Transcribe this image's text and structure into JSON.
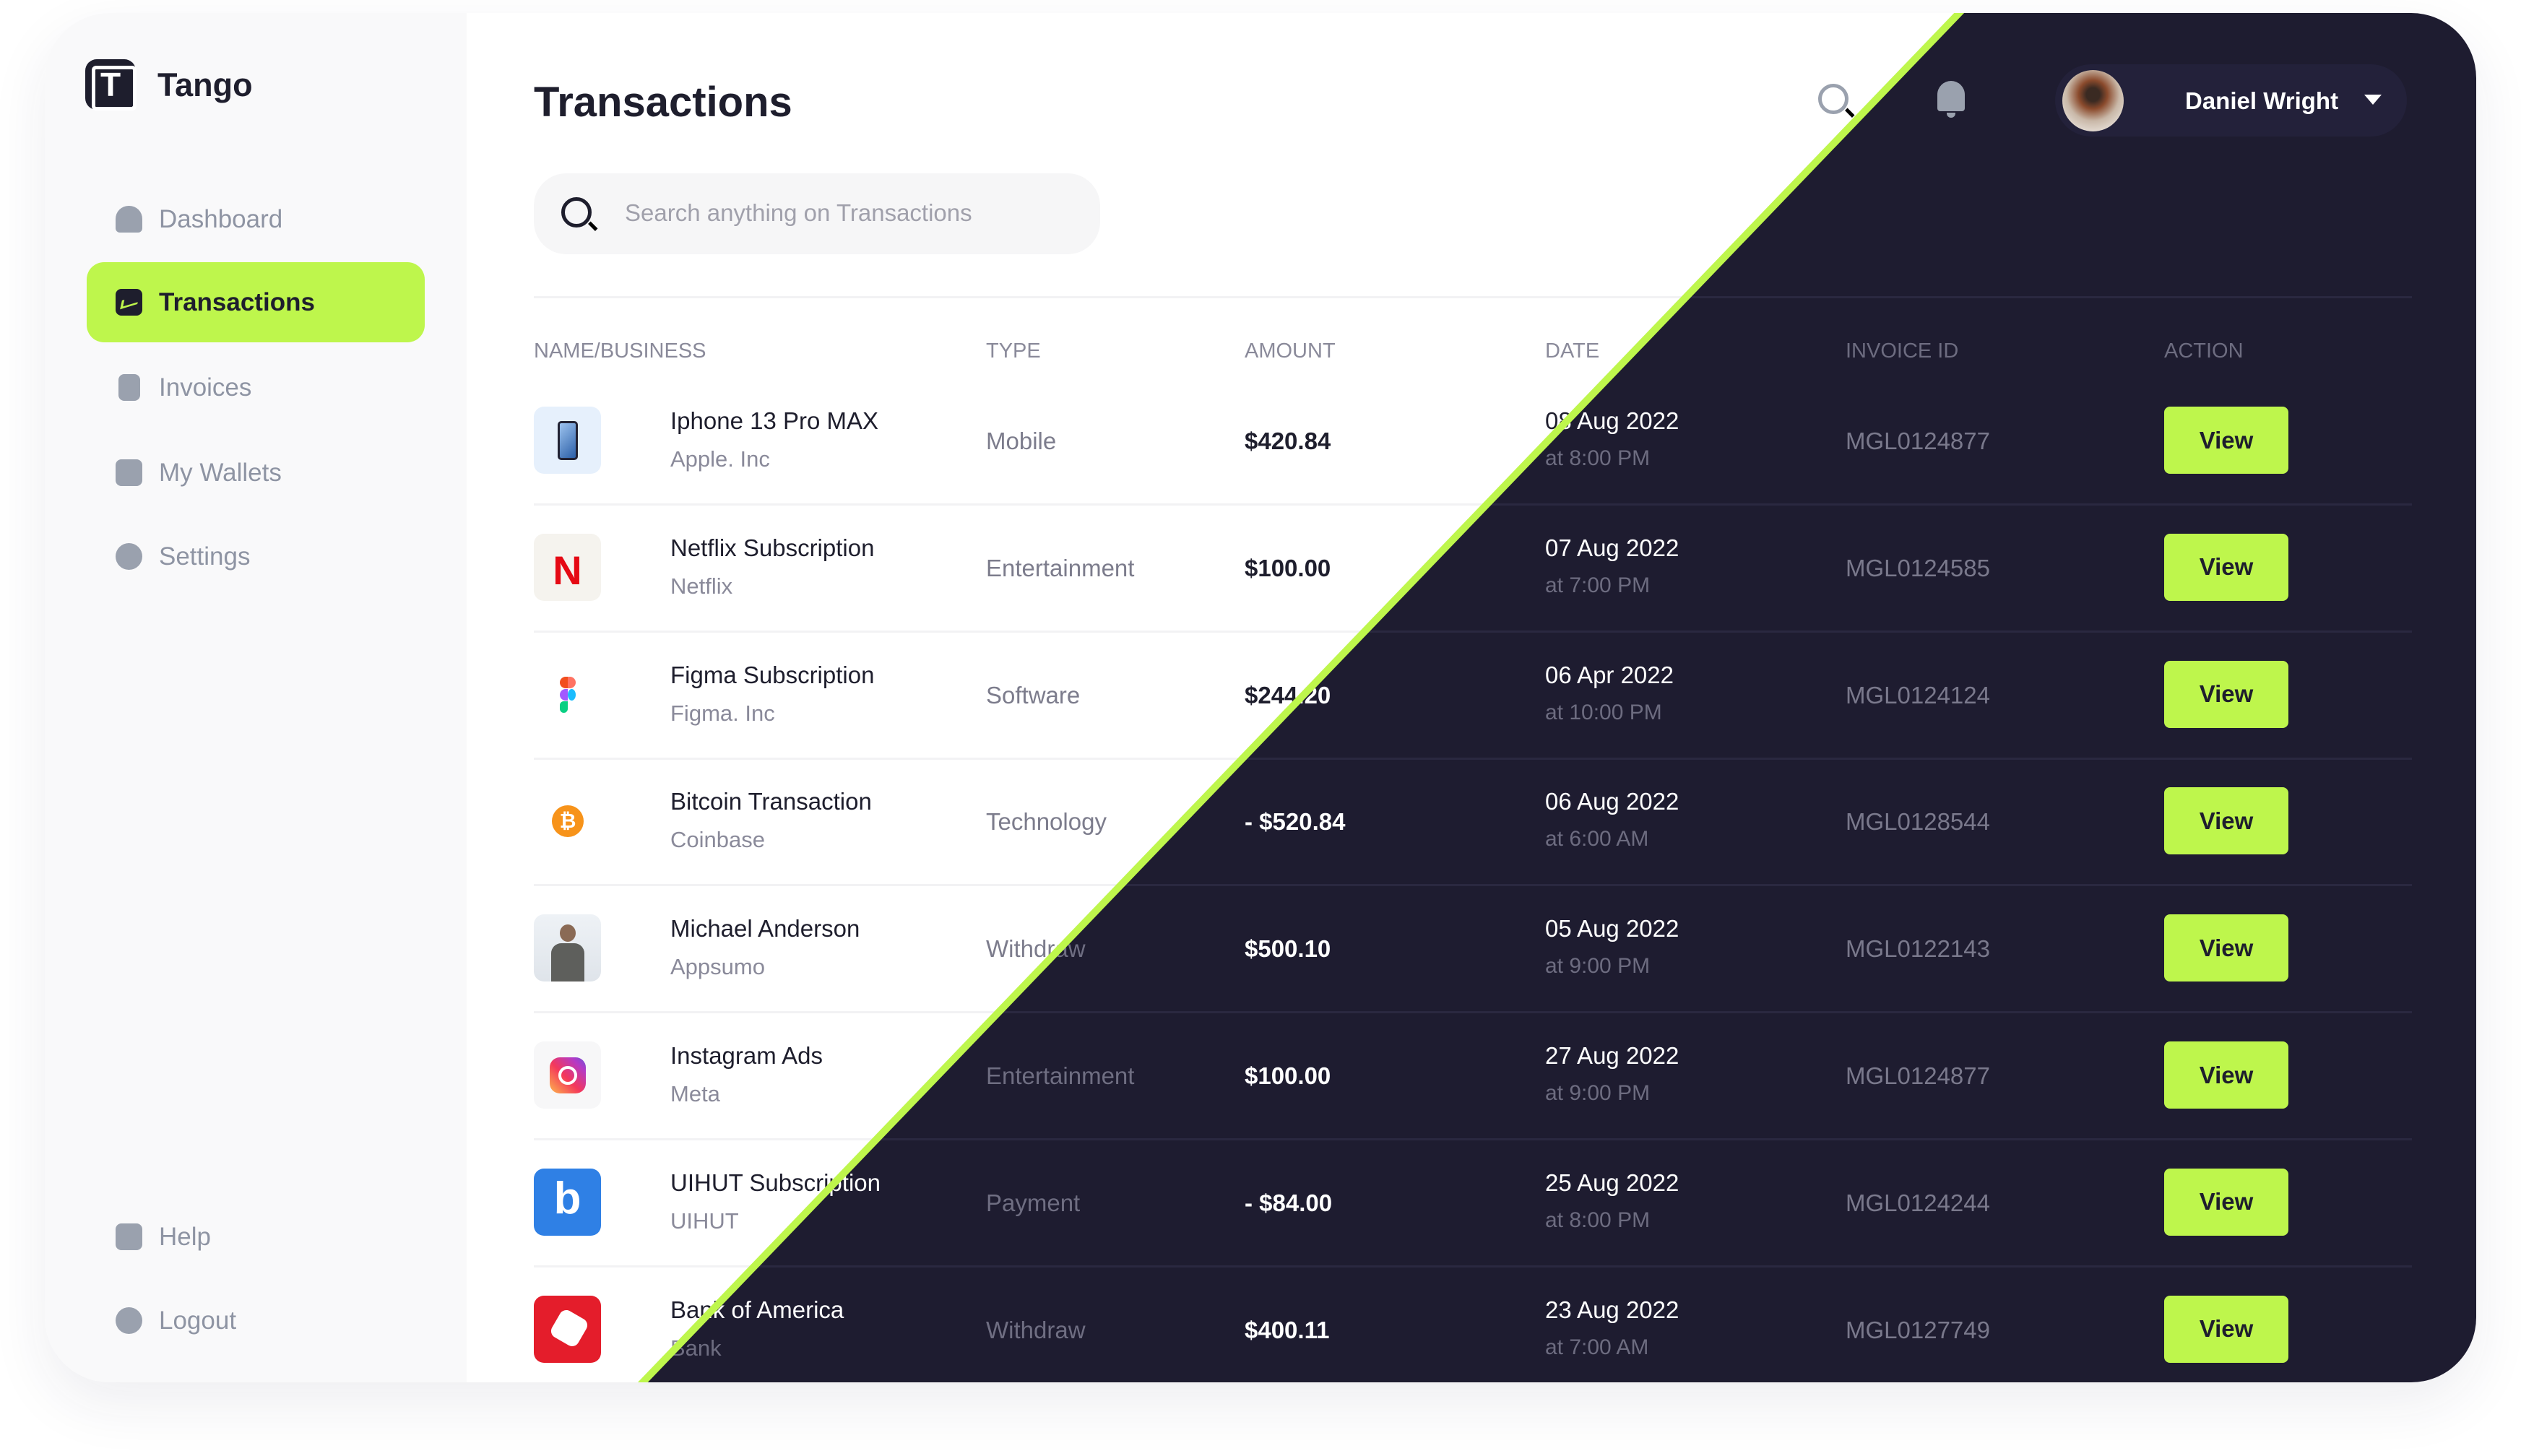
{
  "app": {
    "name": "Tango"
  },
  "sidebar": {
    "items": [
      {
        "label": "Dashboard",
        "icon": "home-icon",
        "active": false
      },
      {
        "label": "Transactions",
        "icon": "chart-icon",
        "active": true
      },
      {
        "label": "Invoices",
        "icon": "receipt-icon",
        "active": false
      },
      {
        "label": "My Wallets",
        "icon": "wallet-icon",
        "active": false
      },
      {
        "label": "Settings",
        "icon": "gear-icon",
        "active": false
      }
    ],
    "bottom": [
      {
        "label": "Help",
        "icon": "help-icon"
      },
      {
        "label": "Logout",
        "icon": "logout-icon"
      }
    ]
  },
  "header": {
    "title": "Transactions",
    "search_placeholder": "Search anything on Transactions",
    "user_name": "Daniel Wright"
  },
  "table": {
    "columns": [
      "NAME/BUSINESS",
      "TYPE",
      "AMOUNT",
      "DATE",
      "INVOICE ID",
      "ACTION"
    ],
    "rows": [
      {
        "name": "Iphone 13 Pro MAX",
        "business": "Apple. Inc",
        "type": "Mobile",
        "amount": "$420.84",
        "date": "08 Aug 2022",
        "time": "at 8:00 PM",
        "invoice": "MGL0124877",
        "action": "View",
        "logo": "iphone"
      },
      {
        "name": "Netflix Subscription",
        "business": "Netflix",
        "type": "Entertainment",
        "amount": "$100.00",
        "date": "07 Aug 2022",
        "time": "at 7:00 PM",
        "invoice": "MGL0124585",
        "action": "View",
        "logo": "netflix"
      },
      {
        "name": "Figma Subscription",
        "business": "Figma. Inc",
        "type": "Software",
        "amount": "$244.20",
        "date": "06 Apr 2022",
        "time": "at 10:00 PM",
        "invoice": "MGL0124124",
        "action": "View",
        "logo": "figma"
      },
      {
        "name": "Bitcoin Transaction",
        "business": "Coinbase",
        "type": "Technology",
        "amount": "-  $520.84",
        "date": "06 Aug 2022",
        "time": "at 6:00 AM",
        "invoice": "MGL0128544",
        "action": "View",
        "logo": "bitcoin"
      },
      {
        "name": "Michael Anderson",
        "business": "Appsumo",
        "type": "Withdraw",
        "amount": "$500.10",
        "date": "05 Aug 2022",
        "time": "at 9:00 PM",
        "invoice": "MGL0122143",
        "action": "View",
        "logo": "person"
      },
      {
        "name": "Instagram Ads",
        "business": "Meta",
        "type": "Entertainment",
        "amount": "$100.00",
        "date": "27 Aug 2022",
        "time": "at 9:00 PM",
        "invoice": "MGL0124877",
        "action": "View",
        "logo": "instagram"
      },
      {
        "name": "UIHUT Subscription",
        "business": "UIHUT",
        "type": "Payment",
        "amount": "-  $84.00",
        "date": "25 Aug 2022",
        "time": "at 8:00 PM",
        "invoice": "MGL0124244",
        "action": "View",
        "logo": "uihut"
      },
      {
        "name": "Bank of America",
        "business": "Bank",
        "type": "Withdraw",
        "amount": "$400.11",
        "date": "23 Aug 2022",
        "time": "at 7:00 AM",
        "invoice": "MGL0127749",
        "action": "View",
        "logo": "bofa"
      }
    ]
  },
  "colors": {
    "accent": "#bef64c",
    "dark": "#1e1c30",
    "text": "#1e1e2d"
  }
}
